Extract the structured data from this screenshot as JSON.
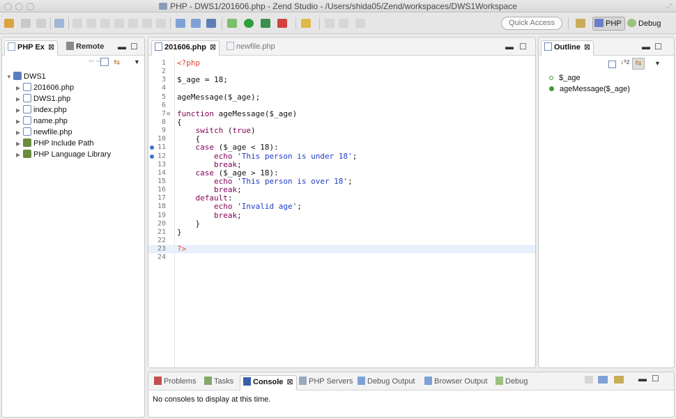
{
  "window": {
    "title": "PHP - DWS1/201606.php - Zend Studio - /Users/shida05/Zend/workspaces/DWS1Workspace"
  },
  "toolbar": {
    "quick_access": "Quick Access",
    "perspectives": [
      {
        "label": "PHP",
        "active": true,
        "icon": "php-perspective-icon"
      },
      {
        "label": "Debug",
        "active": false,
        "icon": "debug-perspective-icon"
      }
    ]
  },
  "explorer": {
    "tabs": [
      {
        "label": "PHP Ex",
        "active": true,
        "close": "⊠"
      },
      {
        "label": "Remote",
        "active": false
      }
    ],
    "tree": [
      {
        "label": "DWS1",
        "level": 0,
        "expanded": true,
        "icon": "php-project-icon"
      },
      {
        "label": "201606.php",
        "level": 1,
        "icon": "php-file-icon"
      },
      {
        "label": "DWS1.php",
        "level": 1,
        "icon": "php-file-icon"
      },
      {
        "label": "index.php",
        "level": 1,
        "icon": "php-file-icon"
      },
      {
        "label": "name.php",
        "level": 1,
        "icon": "php-file-icon"
      },
      {
        "label": "newfile.php",
        "level": 1,
        "icon": "php-file-icon"
      },
      {
        "label": "PHP Include Path",
        "level": 1,
        "icon": "library-icon"
      },
      {
        "label": "PHP Language Library",
        "level": 1,
        "icon": "library-icon"
      }
    ]
  },
  "editor": {
    "tabs": [
      {
        "label": "201606.php",
        "active": true,
        "close": "⊠"
      },
      {
        "label": "newfile.php",
        "active": false
      }
    ],
    "lines": [
      {
        "n": "1",
        "text": "<?php"
      },
      {
        "n": "2",
        "text": ""
      },
      {
        "n": "3",
        "text": "$_age = 18;"
      },
      {
        "n": "4",
        "text": ""
      },
      {
        "n": "5",
        "text": "ageMessage($_age);"
      },
      {
        "n": "6",
        "text": ""
      },
      {
        "n": "7",
        "text": "function ageMessage($_age)"
      },
      {
        "n": "8",
        "text": "{"
      },
      {
        "n": "9",
        "text": "    switch (true)"
      },
      {
        "n": "10",
        "text": "    {"
      },
      {
        "n": "11",
        "text": "    case ($_age < 18):"
      },
      {
        "n": "12",
        "text": "        echo 'This person is under 18';"
      },
      {
        "n": "13",
        "text": "        break;"
      },
      {
        "n": "14",
        "text": "    case ($_age > 18):"
      },
      {
        "n": "15",
        "text": "        echo 'This person is over 18';"
      },
      {
        "n": "16",
        "text": "        break;"
      },
      {
        "n": "17",
        "text": "    default:"
      },
      {
        "n": "18",
        "text": "        echo 'Invalid age';"
      },
      {
        "n": "19",
        "text": "        break;"
      },
      {
        "n": "20",
        "text": "    }"
      },
      {
        "n": "21",
        "text": "}"
      },
      {
        "n": "22",
        "text": ""
      },
      {
        "n": "23",
        "text": "?>"
      },
      {
        "n": "24",
        "text": ""
      }
    ]
  },
  "outline": {
    "tab": {
      "label": "Outline",
      "close": "⊠"
    },
    "items": [
      {
        "label": "$_age",
        "icon": "variable-icon"
      },
      {
        "label": "ageMessage($_age)",
        "icon": "function-icon"
      }
    ]
  },
  "console": {
    "tabs": [
      {
        "label": "Problems",
        "active": false
      },
      {
        "label": "Tasks",
        "active": false
      },
      {
        "label": "Console",
        "active": true,
        "close": "⊠"
      },
      {
        "label": "PHP Servers",
        "active": false
      },
      {
        "label": "Debug Output",
        "active": false
      },
      {
        "label": "Browser Output",
        "active": false
      },
      {
        "label": "Debug",
        "active": false
      }
    ],
    "message": "No consoles to display at this time."
  },
  "colors": {
    "php_tag": "#e0443a",
    "keyword": "#7f0055",
    "string": "#1f3cc5",
    "current_line": "#e8f0fb",
    "variable_dot": "#3a9b3a",
    "function_dot": "#3a9b3a"
  }
}
